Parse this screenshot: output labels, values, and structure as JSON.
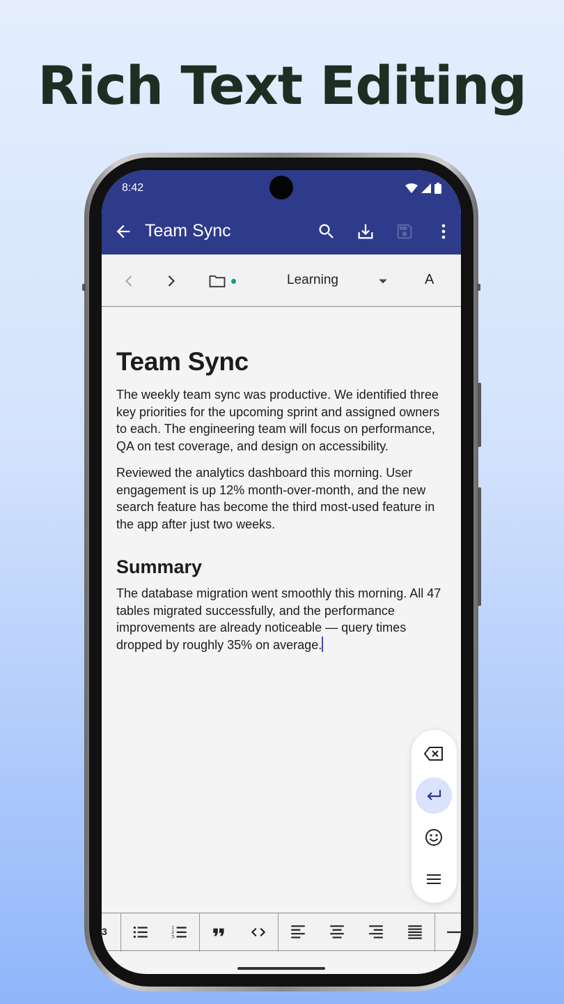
{
  "headline": "Rich Text Editing",
  "status": {
    "time": "8:42"
  },
  "appbar": {
    "title": "Team Sync",
    "icons": [
      "back-arrow-icon",
      "search-icon",
      "download-icon",
      "save-icon",
      "more-vert-icon"
    ],
    "color": "#2e3a8a"
  },
  "nav": {
    "notebook": "Learning",
    "font_label": "A",
    "icons": [
      "chevron-left-icon",
      "chevron-right-icon",
      "folder-icon",
      "dropdown-icon"
    ]
  },
  "document": {
    "title": "Team Sync",
    "paragraphs": [
      "The weekly team sync was productive. We identified three key priorities for the upcoming sprint and assigned owners to each. The engineering team will focus on performance, QA on test coverage, and design on accessibility.",
      "Reviewed the analytics dashboard this morning. User engagement is up 12% month-over-month, and the new search feature has become the third most-used feature in the app after just two weeks."
    ],
    "section_heading": "Summary",
    "section_paragraph": "The database migration went smoothly this morning. All 47 tables migrated successfully, and the performance improvements are already noticeable — query times dropped by roughly 35% on average."
  },
  "keyboard_panel": {
    "icons": [
      "backspace-icon",
      "enter-icon",
      "emoji-icon",
      "menu-icon"
    ]
  },
  "format_toolbar": {
    "partial_heading": "3",
    "icons": [
      "bullet-list-icon",
      "numbered-list-icon",
      "quote-icon",
      "code-icon",
      "align-left-icon",
      "align-center-icon",
      "align-right-icon",
      "align-justify-icon",
      "horizontal-rule-icon"
    ]
  }
}
